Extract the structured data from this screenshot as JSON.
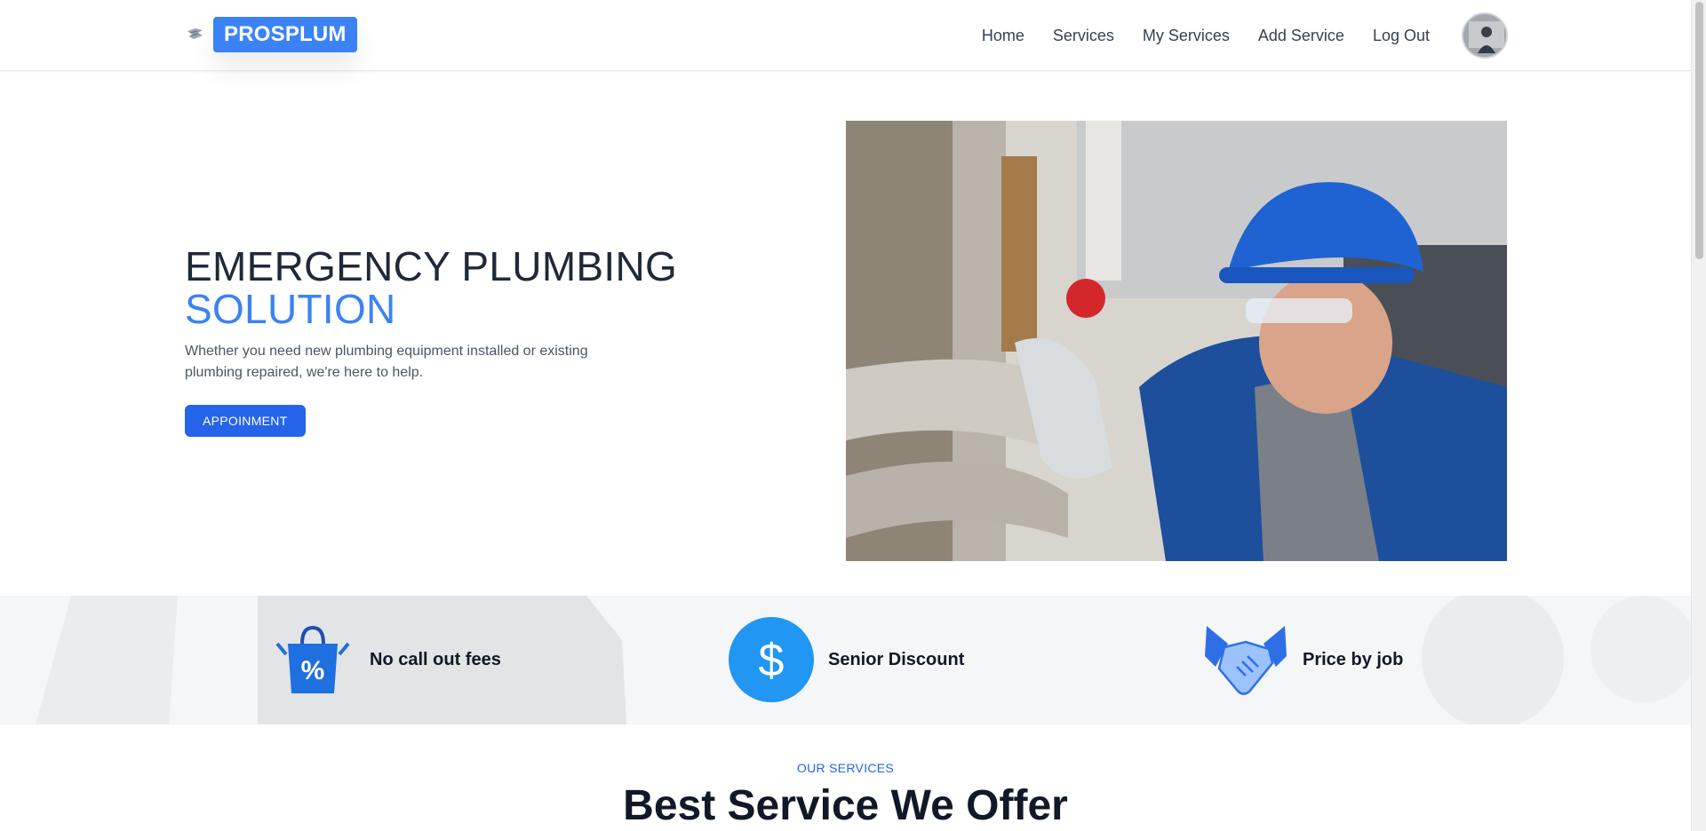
{
  "header": {
    "logo_text": "PROSPLUM",
    "nav": [
      {
        "label": "Home"
      },
      {
        "label": "Services"
      },
      {
        "label": "My Services"
      },
      {
        "label": "Add Service"
      },
      {
        "label": "Log Out"
      }
    ]
  },
  "hero": {
    "title_line1": "EMERGENCY PLUMBING",
    "title_line2": "SOLUTION",
    "subtitle": "Whether you need new plumbing equipment installed or existing plumbing repaired, we're here to help.",
    "button_label": "APPOINMENT",
    "image_icon": "plumber-photo"
  },
  "features": [
    {
      "label": "No call out fees",
      "icon": "discount-bag-icon"
    },
    {
      "label": "Senior Discount",
      "icon": "dollar-icon"
    },
    {
      "label": "Price by job",
      "icon": "handshake-icon"
    }
  ],
  "services": {
    "tag": "OUR SERVICES",
    "title": "Best Service We Offer"
  },
  "colors": {
    "primary": "#3b82f6",
    "button": "#2563eb",
    "text_dark": "#1f2937"
  }
}
